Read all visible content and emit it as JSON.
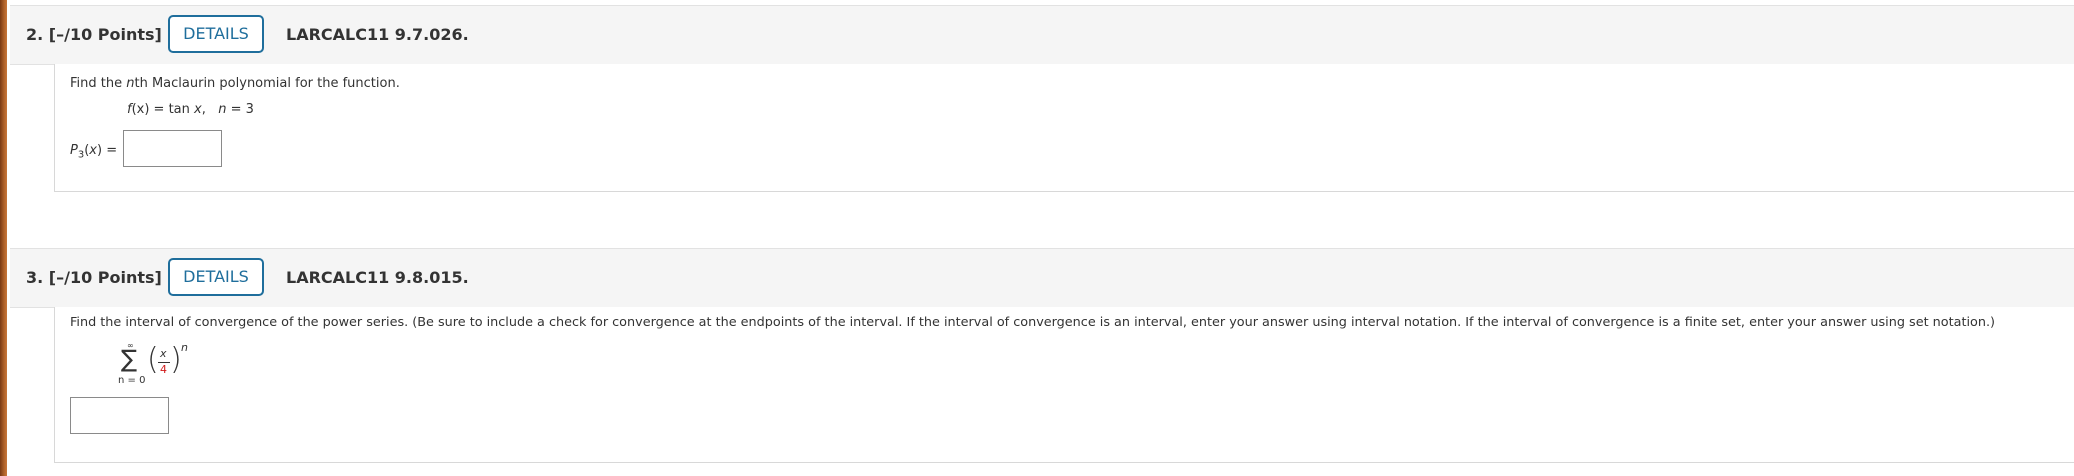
{
  "questions": [
    {
      "number_points": "2.  [–/10 Points]",
      "details_label": "DETAILS",
      "code": "LARCALC11 9.7.026.",
      "prompt": {
        "pre": "Find the ",
        "italic": "n",
        "post": "th Maclaurin polynomial for the function."
      },
      "function": {
        "f": "f",
        "x_arg": "(x)",
        "eq": " = tan ",
        "x": "x",
        "comma": ",",
        "n": "n",
        "n_eq": " = 3"
      },
      "answer_label": {
        "P": "P",
        "sub": "3",
        "arg_open": "(",
        "x": "x",
        "arg_close": ") ="
      },
      "answer_value": ""
    },
    {
      "number_points": "3.  [–/10 Points]",
      "details_label": "DETAILS",
      "code": "LARCALC11 9.8.015.",
      "prompt": "Find the interval of convergence of the power series. (Be sure to include a check for convergence at the endpoints of the interval. If the interval of convergence is an interval, enter your answer using interval notation. If the interval of convergence is a finite set, enter your answer using set notation.)",
      "series": {
        "sigma": "∑",
        "upper": "∞",
        "lower": "n = 0",
        "numerator": "x",
        "denominator": "4",
        "exponent": "n",
        "lparen": "(",
        "rparen": ")"
      },
      "answer_value": ""
    }
  ],
  "colors": {
    "details_border": "#1f6e9c",
    "header_bg": "#f5f5f5",
    "denominator_red": "#d11b1b",
    "left_strip": "#b0622a"
  }
}
